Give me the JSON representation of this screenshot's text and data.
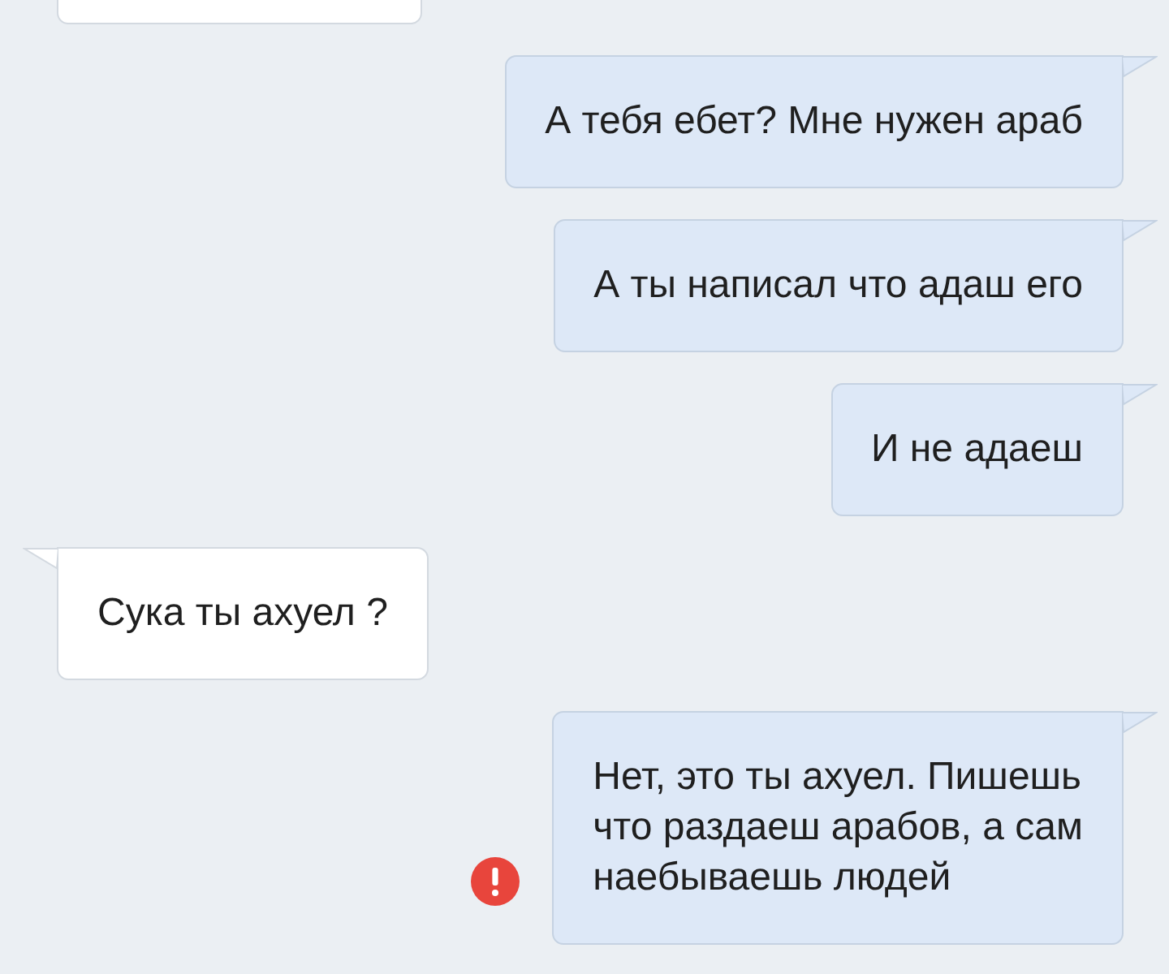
{
  "messages": [
    {
      "kind": "incoming"
    },
    {
      "kind": "outgoing",
      "text": "А тебя ебет? Мне нужен араб",
      "failed": false
    },
    {
      "kind": "outgoing",
      "text": "А ты написал что адаш его",
      "failed": false
    },
    {
      "kind": "outgoing",
      "text": "И не адаеш",
      "failed": false
    },
    {
      "kind": "incoming",
      "text": "Сука ты ахуел ?",
      "failed": false
    },
    {
      "kind": "outgoing",
      "text": "Нет, это ты ахуел. Пишешь\nчто раздаеш арабов, а сам\nнаебываешь людей",
      "failed": true
    }
  ]
}
